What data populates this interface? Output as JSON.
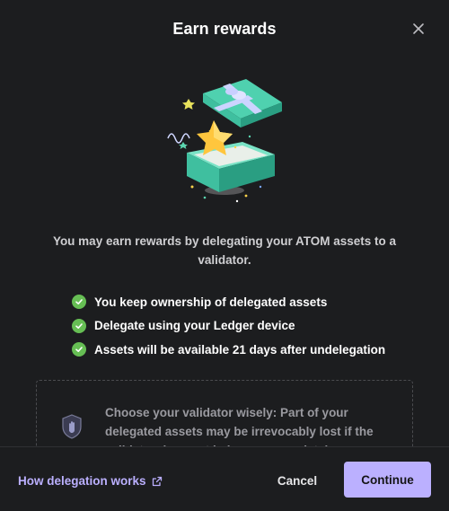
{
  "dialog": {
    "title": "Earn rewards",
    "intro": "You may earn rewards by delegating your ATOM assets to a validator.",
    "checklist": [
      "You keep ownership of delegated assets",
      "Delegate using your Ledger device",
      "Assets will be available 21 days after undelegation"
    ],
    "warning": "Choose your validator wisely: Part of your delegated assets may be irrevocably lost if the validator does not behave appropriately."
  },
  "footer": {
    "link_label": "How delegation works",
    "cancel_label": "Cancel",
    "continue_label": "Continue"
  },
  "icons": {
    "close": "close-icon",
    "illustration": "gift-box-illustration",
    "check": "check-circle-icon",
    "shield": "shield-hand-icon",
    "external": "external-link-icon"
  },
  "colors": {
    "background": "#1c1d1f",
    "accent": "#bbb0ff",
    "success": "#66be54",
    "gift": "#3fbf9f"
  }
}
